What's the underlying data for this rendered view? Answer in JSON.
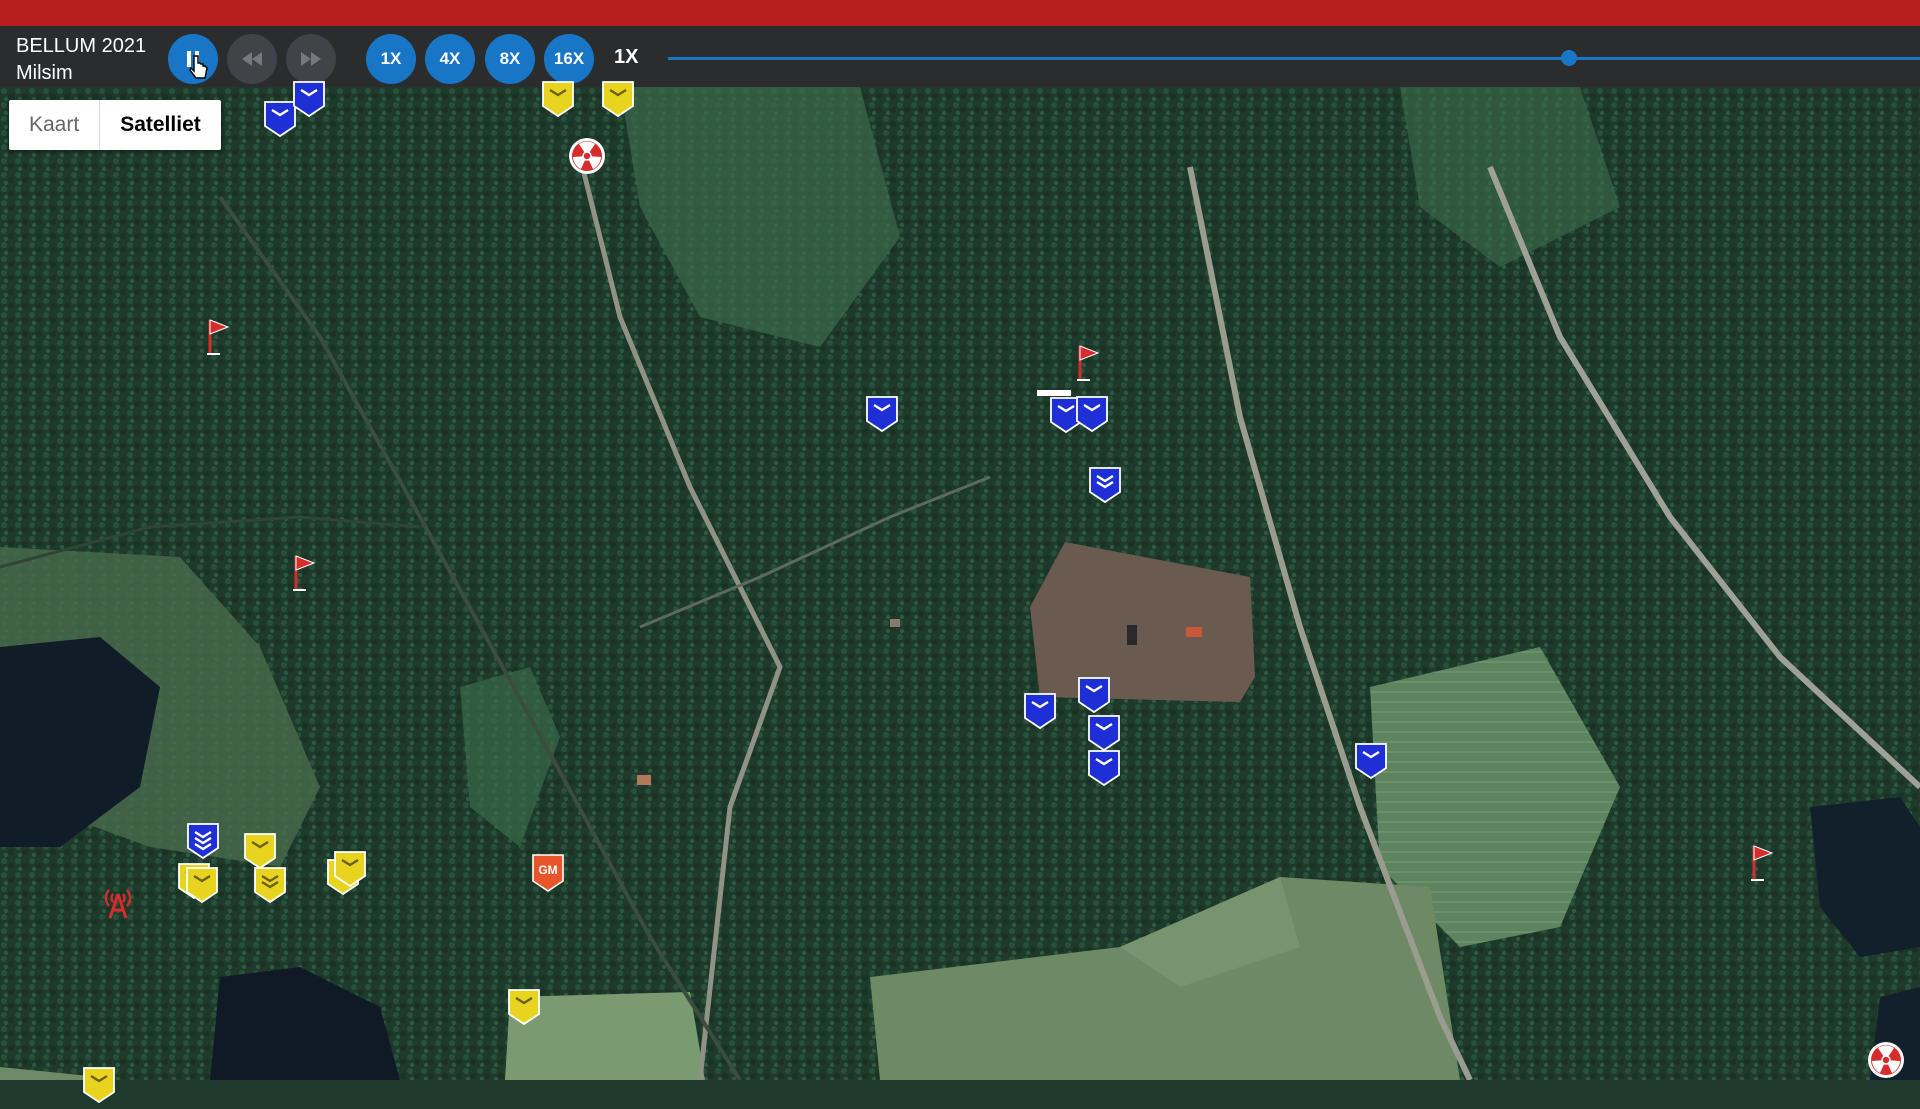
{
  "app": {
    "title_line1": "BELLUM 2021",
    "title_line2": "Milsim"
  },
  "playback": {
    "current_speed_label": "1X",
    "speed_buttons": [
      {
        "label": "1X"
      },
      {
        "label": "4X"
      },
      {
        "label": "8X"
      },
      {
        "label": "16X"
      }
    ],
    "timeline_position": 0.72
  },
  "map_type": {
    "map_label": "Kaart",
    "satellite_label": "Satelliet",
    "selected": "Satelliet"
  },
  "colors": {
    "topbar": "#b81d1d",
    "toolbar": "#2a2c2e",
    "accent": "#1976c7",
    "blue_unit": "#1f2fd6",
    "yellow_unit": "#e8d41f",
    "objective_red": "#d72c2c",
    "gm_orange": "#e8552b"
  },
  "markers": {
    "gm_label": "GM",
    "types": [
      "blue-unit-icon",
      "yellow-unit-icon",
      "red-flag-icon",
      "radioactive-objective-icon",
      "radio-tower-icon",
      "gm-marker-icon"
    ]
  }
}
